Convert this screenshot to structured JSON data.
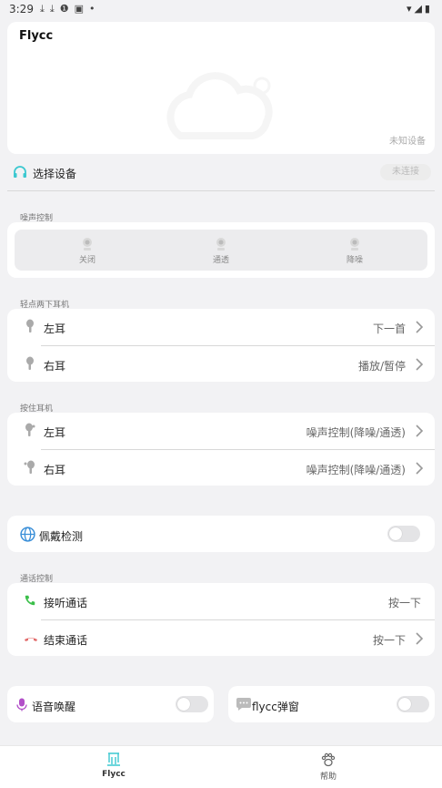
{
  "status_bar": {
    "time": "3:29"
  },
  "device_card": {
    "title": "Flycc",
    "status": "未知设备"
  },
  "select_device": {
    "label": "选择设备",
    "button": "未连接"
  },
  "noise_control": {
    "section_label": "噪声控制",
    "options": [
      {
        "label": "关闭"
      },
      {
        "label": "通透"
      },
      {
        "label": "降噪"
      }
    ]
  },
  "double_tap": {
    "section_label": "轻点两下耳机",
    "rows": [
      {
        "label": "左耳",
        "value": "下一首"
      },
      {
        "label": "右耳",
        "value": "播放/暂停"
      }
    ]
  },
  "press_hold": {
    "section_label": "按住耳机",
    "rows": [
      {
        "label": "左耳",
        "value": "噪声控制(降噪/通透)"
      },
      {
        "label": "右耳",
        "value": "噪声控制(降噪/通透)"
      }
    ]
  },
  "wear_detection": {
    "label": "佩戴检测",
    "enabled": false
  },
  "call_control": {
    "section_label": "通话控制",
    "rows": [
      {
        "label": "接听通话",
        "value": "按一下"
      },
      {
        "label": "结束通话",
        "value": "按一下"
      }
    ]
  },
  "voice_wake": {
    "label": "语音唤醒",
    "enabled": false
  },
  "flycc_popup": {
    "label": "flycc弹窗",
    "enabled": false
  },
  "bottom_nav": {
    "tabs": [
      {
        "label": "Flycc"
      },
      {
        "label": "帮助"
      }
    ]
  },
  "colors": {
    "accent": "#3cc8d0",
    "call_green": "#3bbf4a",
    "call_red": "#e26b6b",
    "mic_purple": "#b24fc8"
  }
}
